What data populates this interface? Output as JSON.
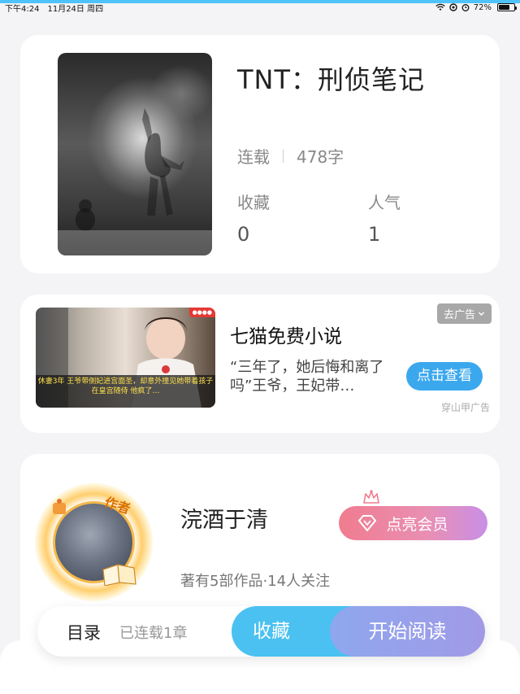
{
  "status_bar": {
    "time": "下午4:24",
    "date": "11月24日 周四",
    "battery": "72%",
    "battery_level": 0.72,
    "icons": [
      "wifi-icon",
      "location-icon",
      "alarm-icon",
      "battery-icon"
    ]
  },
  "book": {
    "title": "TNT：刑侦笔记",
    "status": "连载",
    "word_count": "478字",
    "stats": [
      {
        "label": "收藏",
        "value": "0"
      },
      {
        "label": "人气",
        "value": "1"
      }
    ]
  },
  "ad": {
    "tag_label": "去广告",
    "title": "七猫免费小说",
    "description": "“三年了，她后悔和离了吗”王爷，王妃带…",
    "action_label": "点击查看",
    "source": "穿山甲广告",
    "image_caption": "休妻3年 王爷带侧妃进宫面圣，却意外撞见她带着孩子 在皇宫随侍  他疯了…"
  },
  "author": {
    "badge": "作者",
    "name": "浣酒于清",
    "vip_label": "点亮会员",
    "works_info": "著有5部作品·14人关注"
  },
  "action_bar": {
    "toc_label": "目录",
    "toc_progress": "已连载1章",
    "favorite_label": "收藏",
    "read_label": "开始阅读"
  },
  "colors": {
    "accent_blue": "#4ac1f0",
    "ad_button": "#3ba8ee",
    "vip_pink": "#f07c8e",
    "vip_purple": "#c88fe6"
  }
}
